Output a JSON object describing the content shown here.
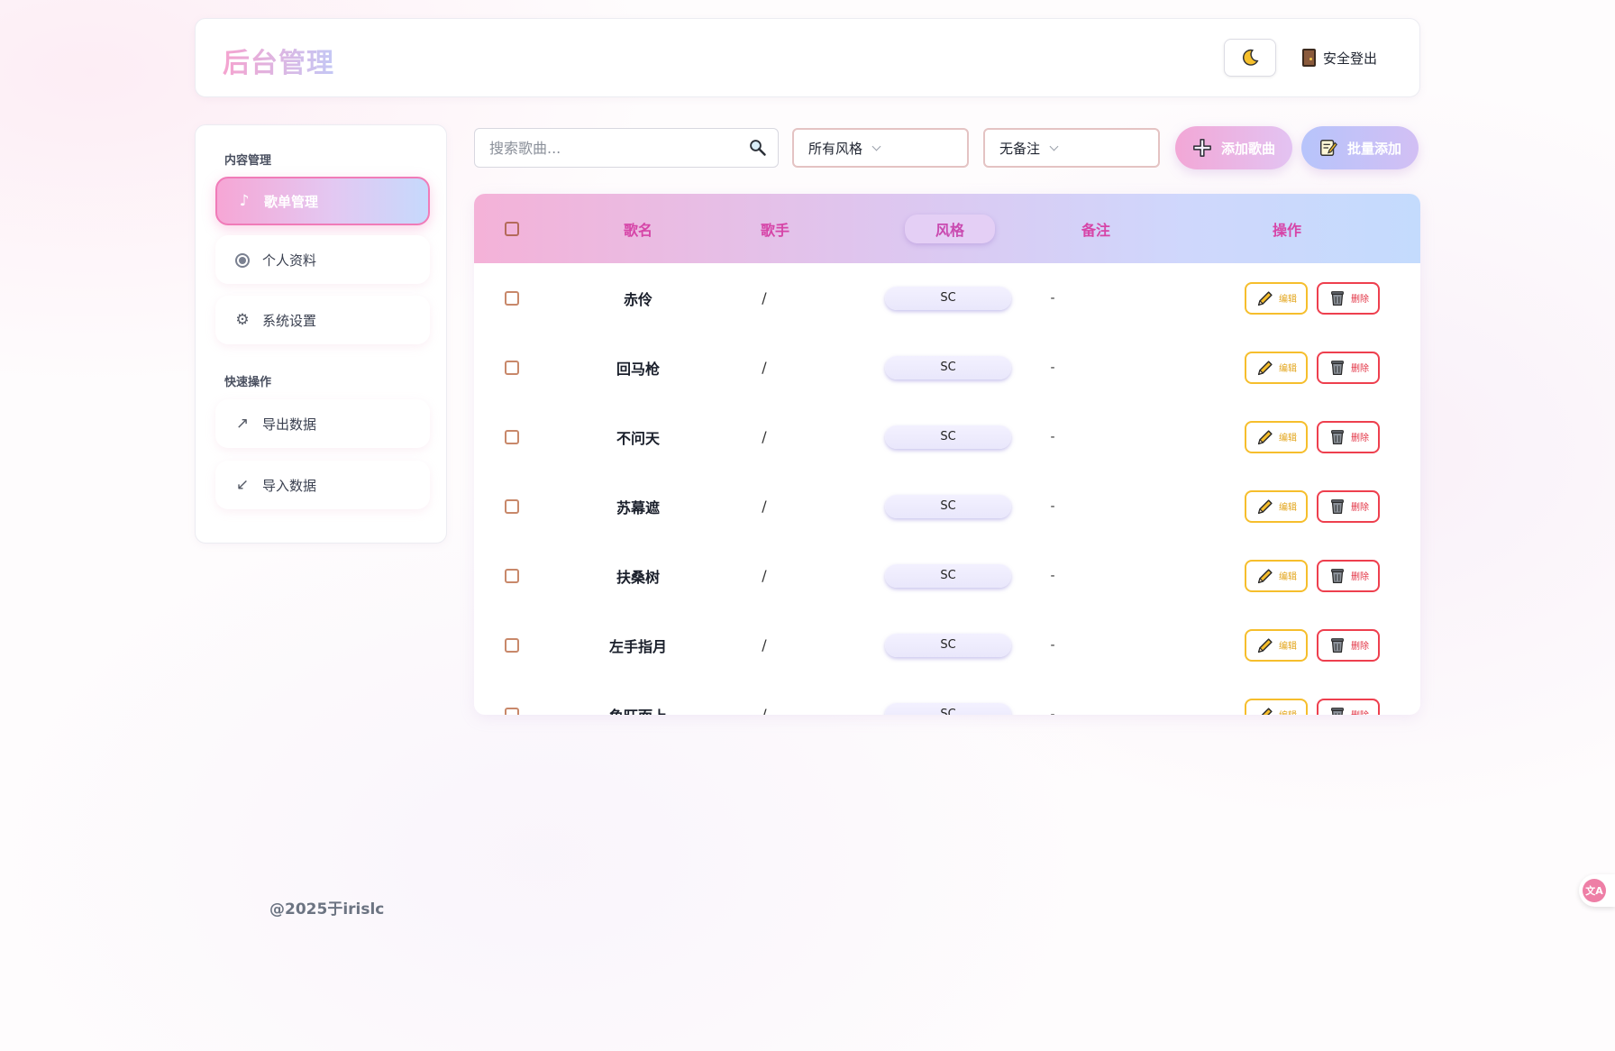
{
  "header": {
    "brand": "后台管理",
    "theme_icon": "moon-icon",
    "logout_label": "安全登出"
  },
  "sidebar": {
    "content_section": "内容管理",
    "quick_section": "快速操作",
    "items": [
      {
        "label": "歌单管理",
        "icon": "music-note-icon",
        "glyph": "♪"
      },
      {
        "label": "个人资料",
        "icon": "radio-icon"
      },
      {
        "label": "系统设置",
        "icon": "gear-icon",
        "glyph": "⚙"
      }
    ],
    "quick_items": [
      {
        "label": "导出数据",
        "icon": "arrow-up-right-icon",
        "glyph": "↗"
      },
      {
        "label": "导入数据",
        "icon": "arrow-down-left-icon",
        "glyph": "↙"
      }
    ]
  },
  "toolbar": {
    "search_placeholder": "搜索歌曲...",
    "style_filter": "所有风格",
    "note_filter": "无备注",
    "add_label": "添加歌曲",
    "batch_label": "批量添加"
  },
  "table": {
    "headers": {
      "name": "歌名",
      "singer": "歌手",
      "style": "风格",
      "note": "备注",
      "actions": "操作"
    },
    "edit_label": "编辑",
    "delete_label": "删除",
    "rows": [
      {
        "name": "赤伶",
        "singer": "/",
        "style": "SC",
        "note": "-"
      },
      {
        "name": "回马枪",
        "singer": "/",
        "style": "SC",
        "note": "-"
      },
      {
        "name": "不问天",
        "singer": "/",
        "style": "SC",
        "note": "-"
      },
      {
        "name": "苏幕遮",
        "singer": "/",
        "style": "SC",
        "note": "-"
      },
      {
        "name": "扶桑树",
        "singer": "/",
        "style": "SC",
        "note": "-"
      },
      {
        "name": "左手指月",
        "singer": "/",
        "style": "SC",
        "note": "-"
      },
      {
        "name": "鱼旺而上",
        "singer": "/",
        "style": "SC",
        "note": "-"
      }
    ]
  },
  "footer": {
    "text": "@2025于irislc"
  },
  "translate": {
    "icon": "translate-icon",
    "glyph": "文A"
  }
}
